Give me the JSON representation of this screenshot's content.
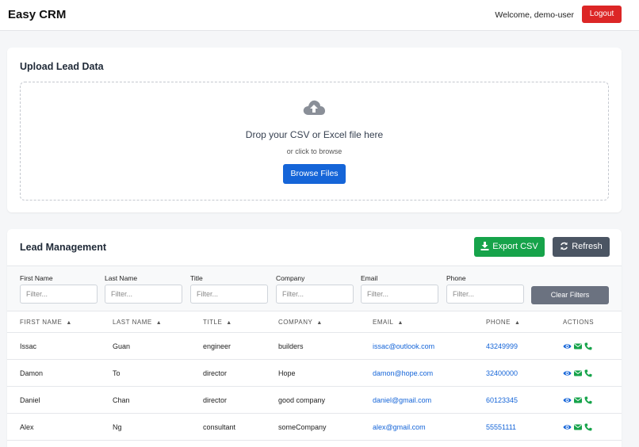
{
  "header": {
    "brand": "Easy CRM",
    "welcome": "Welcome, demo-user",
    "logout_label": "Logout"
  },
  "upload": {
    "title": "Upload Lead Data",
    "drop_text": "Drop your CSV or Excel file here",
    "sub_text": "or click to browse",
    "browse_label": "Browse Files",
    "icon": "cloud-upload-icon"
  },
  "leads": {
    "title": "Lead Management",
    "export_label": "Export CSV",
    "refresh_label": "Refresh",
    "clear_label": "Clear Filters",
    "filters": [
      {
        "label": "First Name",
        "placeholder": "Filter..."
      },
      {
        "label": "Last Name",
        "placeholder": "Filter..."
      },
      {
        "label": "Title",
        "placeholder": "Filter..."
      },
      {
        "label": "Company",
        "placeholder": "Filter..."
      },
      {
        "label": "Email",
        "placeholder": "Filter..."
      },
      {
        "label": "Phone",
        "placeholder": "Filter..."
      }
    ],
    "columns": [
      "FIRST NAME",
      "LAST NAME",
      "TITLE",
      "COMPANY",
      "EMAIL",
      "PHONE",
      "ACTIONS"
    ],
    "rows": [
      {
        "first": "Issac",
        "last": "Guan",
        "title": "engineer",
        "company": "builders",
        "email": "issac@outlook.com",
        "phone": "43249999"
      },
      {
        "first": "Damon",
        "last": "To",
        "title": "director",
        "company": "Hope",
        "email": "damon@hope.com",
        "phone": "32400000"
      },
      {
        "first": "Daniel",
        "last": "Chan",
        "title": "director",
        "company": "good company",
        "email": "daniel@gmail.com",
        "phone": "60123345"
      },
      {
        "first": "Alex",
        "last": "Ng",
        "title": "consultant",
        "company": "someCompany",
        "email": "alex@gmail.com",
        "phone": "55551111"
      }
    ],
    "action_icons": [
      "eye-icon",
      "envelope-icon",
      "phone-icon"
    ]
  },
  "colors": {
    "primary": "#1565d8",
    "success": "#16a34a",
    "danger": "#dc2626",
    "secondary": "#4b5563"
  }
}
